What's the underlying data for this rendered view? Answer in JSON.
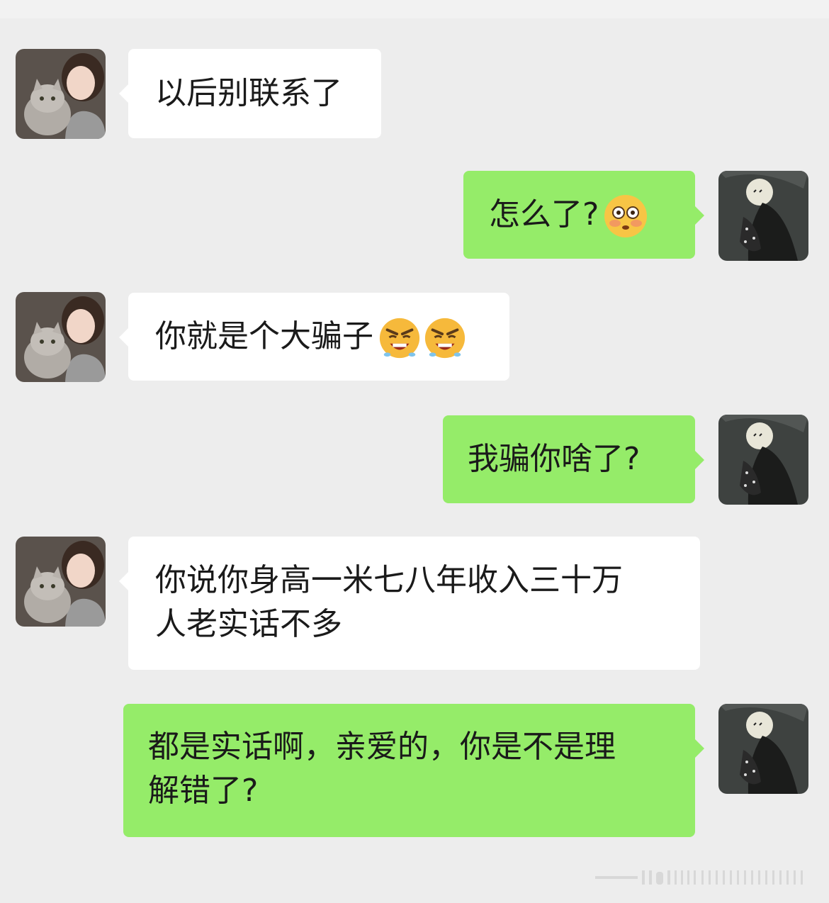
{
  "chat": {
    "messages": [
      {
        "sender": "them",
        "lines": [
          "以后别联系了"
        ],
        "emojis": []
      },
      {
        "sender": "me",
        "lines": [
          "怎么了?"
        ],
        "emojis": [
          "flushed-face-emoji"
        ]
      },
      {
        "sender": "them",
        "lines": [
          "你就是个大骗子"
        ],
        "emojis": [
          "angry-face-emoji",
          "angry-face-emoji"
        ]
      },
      {
        "sender": "me",
        "lines": [
          "我骗你啥了?"
        ],
        "emojis": []
      },
      {
        "sender": "them",
        "lines": [
          "你说你身高一米七八年收入三十万",
          "人老实话不多"
        ],
        "emojis": []
      },
      {
        "sender": "me",
        "lines": [
          "都是实话啊，亲爱的，你是不是理",
          "解错了?"
        ],
        "emojis": []
      }
    ]
  },
  "colors": {
    "background": "#ededed",
    "incoming_bubble": "#ffffff",
    "outgoing_bubble": "#95ec69",
    "text": "#1a1a1a"
  }
}
